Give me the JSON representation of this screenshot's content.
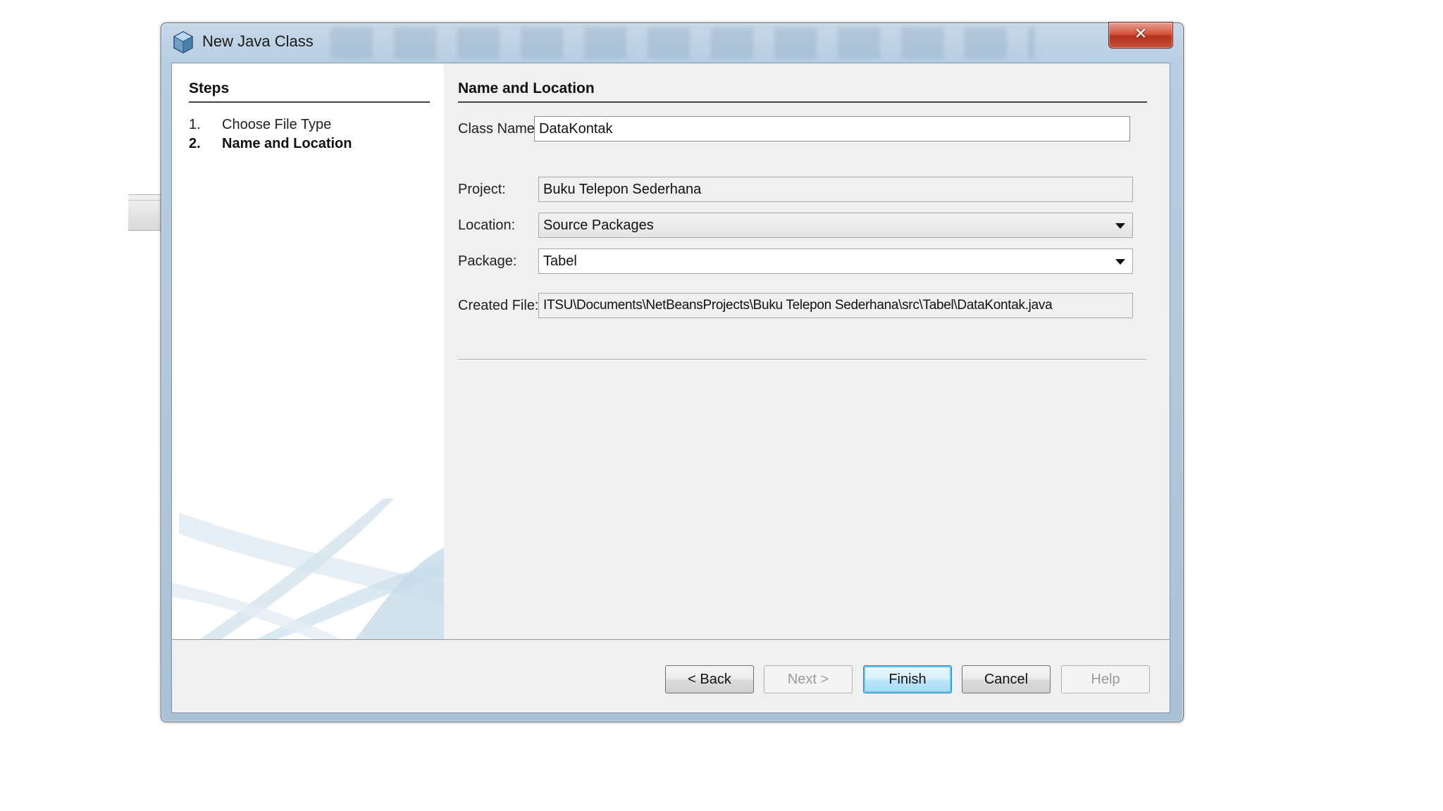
{
  "window": {
    "title": "New Java Class",
    "close_glyph": "✕"
  },
  "steps": {
    "title": "Steps",
    "items": [
      {
        "num": "1.",
        "label": "Choose File Type",
        "current": false
      },
      {
        "num": "2.",
        "label": "Name and Location",
        "current": true
      }
    ]
  },
  "form": {
    "section_title": "Name and Location",
    "class_name": {
      "label": "Class Name:",
      "value": "DataKontak"
    },
    "project": {
      "label": "Project:",
      "value": "Buku Telepon Sederhana"
    },
    "location": {
      "label": "Location:",
      "value": "Source Packages"
    },
    "package": {
      "label": "Package:",
      "value": "Tabel"
    },
    "created_file": {
      "label": "Created File:",
      "value": "ITSU\\Documents\\NetBeansProjects\\Buku Telepon Sederhana\\src\\Tabel\\DataKontak.java"
    }
  },
  "buttons": {
    "back": "< Back",
    "next": "Next >",
    "finish": "Finish",
    "cancel": "Cancel",
    "help": "Help"
  },
  "colors": {
    "default_button_accent": "#3c7fb1",
    "close_button": "#c8513a",
    "frame": "#b4c9dc"
  }
}
